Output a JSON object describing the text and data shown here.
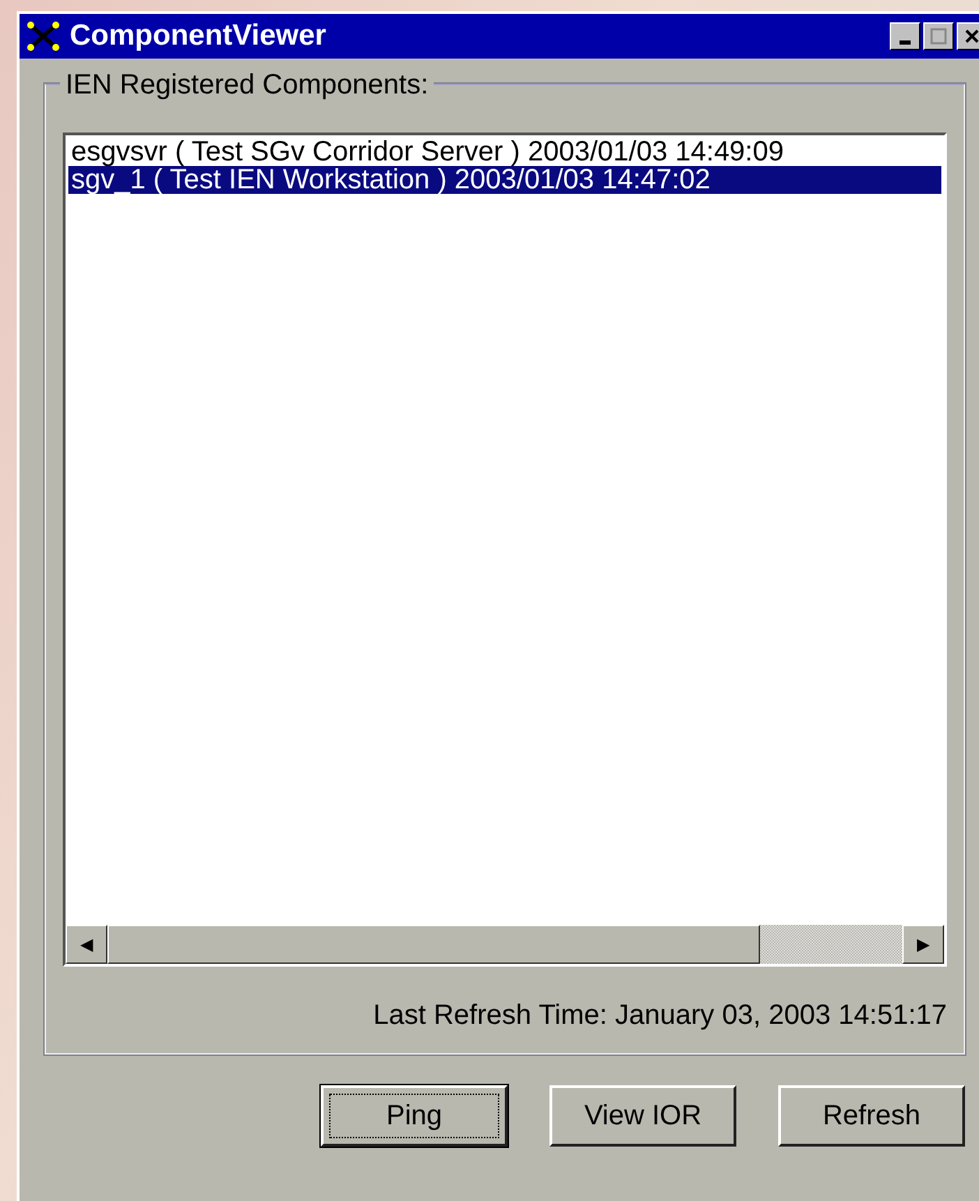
{
  "window": {
    "title": "ComponentViewer"
  },
  "group": {
    "label": "IEN Registered Components:"
  },
  "list": {
    "items": [
      {
        "text": "esgvsvr ( Test SGv Corridor Server ) 2003/01/03 14:49:09",
        "selected": false
      },
      {
        "text": "sgv_1 ( Test IEN Workstation ) 2003/01/03 14:47:02",
        "selected": true
      }
    ],
    "hscroll_left": "◀",
    "hscroll_right": "▶"
  },
  "status": "Last Refresh Time: January 03, 2003 14:51:17",
  "buttons": [
    {
      "label": "Ping",
      "focused": true
    },
    {
      "label": "View IOR",
      "focused": false
    },
    {
      "label": "Refresh",
      "focused": false
    }
  ]
}
